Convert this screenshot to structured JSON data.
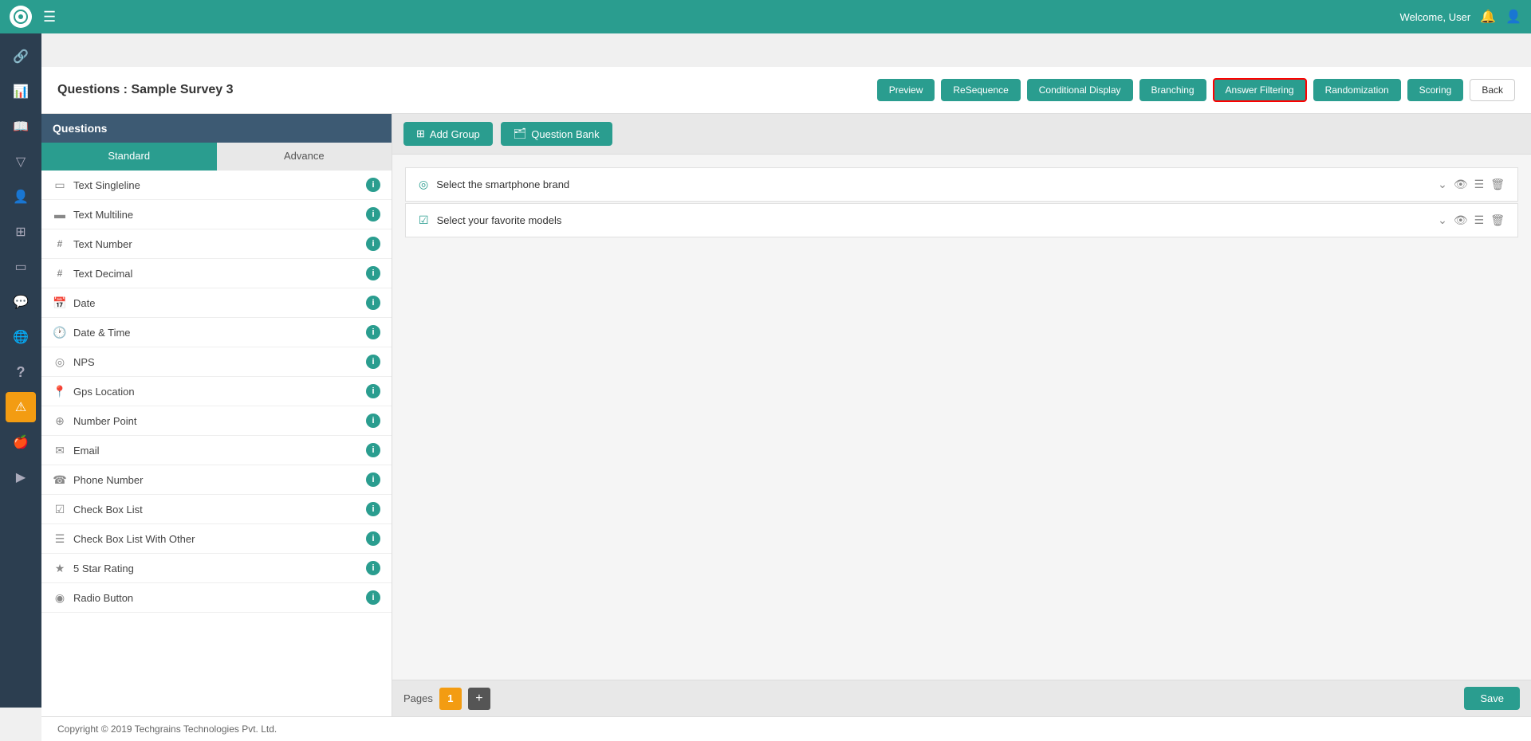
{
  "topbar": {
    "logo": "C",
    "welcome_text": "Welcome, User"
  },
  "header": {
    "title": "Questions : Sample Survey 3",
    "buttons": [
      {
        "label": "Preview",
        "key": "preview",
        "active": false
      },
      {
        "label": "ReSequence",
        "key": "resequence",
        "active": false
      },
      {
        "label": "Conditional Display",
        "key": "conditional_display",
        "active": false
      },
      {
        "label": "Branching",
        "key": "branching",
        "active": false
      },
      {
        "label": "Answer Filtering",
        "key": "answer_filtering",
        "active": true
      },
      {
        "label": "Randomization",
        "key": "randomization",
        "active": false
      },
      {
        "label": "Scoring",
        "key": "scoring",
        "active": false
      },
      {
        "label": "Back",
        "key": "back",
        "active": false
      }
    ]
  },
  "questions_panel": {
    "header": "Questions",
    "tabs": [
      {
        "label": "Standard",
        "active": true
      },
      {
        "label": "Advance",
        "active": false
      }
    ],
    "items": [
      {
        "icon": "▭",
        "label": "Text Singleline"
      },
      {
        "icon": "▬",
        "label": "Text Multiline"
      },
      {
        "icon": "#",
        "label": "Text Number"
      },
      {
        "icon": "#",
        "label": "Text Decimal"
      },
      {
        "icon": "📅",
        "label": "Date"
      },
      {
        "icon": "🕐",
        "label": "Date & Time"
      },
      {
        "icon": "◎",
        "label": "NPS"
      },
      {
        "icon": "📍",
        "label": "Gps Location"
      },
      {
        "icon": "⊕",
        "label": "Number Point"
      },
      {
        "icon": "✉",
        "label": "Email"
      },
      {
        "icon": "☎",
        "label": "Phone Number"
      },
      {
        "icon": "☑",
        "label": "Check Box List"
      },
      {
        "icon": "☰",
        "label": "Check Box List With Other"
      },
      {
        "icon": "★",
        "label": "5 Star Rating"
      },
      {
        "icon": "◉",
        "label": "Radio Button"
      }
    ]
  },
  "toolbar": {
    "add_group_label": "Add Group",
    "question_bank_label": "Question Bank"
  },
  "questions_area": {
    "items": [
      {
        "type": "radio",
        "text": "Select the smartphone brand"
      },
      {
        "type": "checkbox",
        "text": "Select your favorite models"
      }
    ]
  },
  "pages_bar": {
    "label": "Pages",
    "current_page": "1"
  },
  "footer": {
    "text": "Copyright © 2019 Techgrains Technologies Pvt. Ltd."
  },
  "sidebar": {
    "icons": [
      {
        "name": "link-icon",
        "symbol": "🔗",
        "active": false
      },
      {
        "name": "chart-icon",
        "symbol": "📊",
        "active": false
      },
      {
        "name": "book-icon",
        "symbol": "📖",
        "active": false
      },
      {
        "name": "filter-icon",
        "symbol": "▽",
        "active": false
      },
      {
        "name": "user-icon",
        "symbol": "👤",
        "active": false
      },
      {
        "name": "layers-icon",
        "symbol": "⊞",
        "active": false
      },
      {
        "name": "tablet-icon",
        "symbol": "▭",
        "active": false
      },
      {
        "name": "chat-icon",
        "symbol": "💬",
        "active": false
      },
      {
        "name": "globe-icon",
        "symbol": "🌐",
        "active": false
      },
      {
        "name": "question-icon",
        "symbol": "?",
        "active": false
      },
      {
        "name": "alert-icon",
        "symbol": "⚠",
        "active": true
      },
      {
        "name": "apple-icon",
        "symbol": "🍎",
        "active": false
      },
      {
        "name": "play-icon",
        "symbol": "▶",
        "active": false
      }
    ]
  }
}
